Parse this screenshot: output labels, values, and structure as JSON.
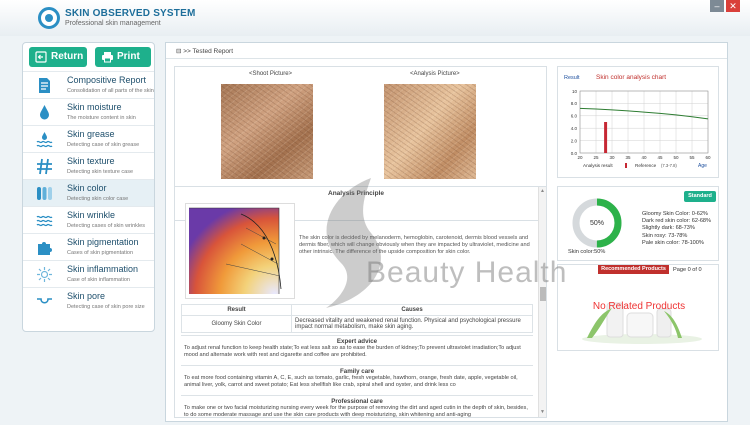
{
  "app": {
    "title": "SKIN OBSERVED SYSTEM",
    "subtitle": "Professional skin management"
  },
  "window": {
    "min": "–",
    "close": "✕"
  },
  "toolbar": {
    "return_label": "Return",
    "print_label": "Print"
  },
  "sidebar": {
    "items": [
      {
        "title": "Compositive Report",
        "sub": "Consolidation of all parts of the skin",
        "icon": "document-icon"
      },
      {
        "title": "Skin moisture",
        "sub": "The moisture content in skin",
        "icon": "water-drop-icon"
      },
      {
        "title": "Skin grease",
        "sub": "Detecting case of skin grease",
        "icon": "grease-waves-icon"
      },
      {
        "title": "Skin texture",
        "sub": "Detecting skin texture case",
        "icon": "texture-hash-icon"
      },
      {
        "title": "Skin color",
        "sub": "Detecting skin color case",
        "icon": "color-bars-icon"
      },
      {
        "title": "Skin wrinkle",
        "sub": "Detecting cases of skin wrinkles",
        "icon": "wrinkle-lines-icon"
      },
      {
        "title": "Skin pigmentation",
        "sub": "Cases of skin pigmentation",
        "icon": "pigment-puzzle-icon"
      },
      {
        "title": "Skin inflammation",
        "sub": "Case of skin inflammation",
        "icon": "inflammation-burst-icon"
      },
      {
        "title": "Skin pore",
        "sub": "Detecting case of skin pore size",
        "icon": "pore-cup-icon"
      }
    ]
  },
  "breadcrumb": "Tested Report",
  "photos": {
    "shoot_label": "<Shoot Picture>",
    "analysis_label": "<Analysis Picture>"
  },
  "chart_data": {
    "type": "line",
    "title": "Skin color analysis chart",
    "ylabel": "Result",
    "xlabel": "Age",
    "x_ticks": [
      20,
      25,
      30,
      35,
      40,
      45,
      50,
      55,
      60
    ],
    "y_ticks": [
      0.0,
      2.0,
      4.0,
      6.0,
      8.0,
      10
    ],
    "xlim": [
      20,
      60
    ],
    "ylim": [
      0,
      10
    ],
    "series": [
      {
        "name": "Reference",
        "x": [
          20,
          25,
          30,
          35,
          40,
          45,
          50,
          55,
          60
        ],
        "values": [
          7.2,
          7.1,
          6.95,
          6.8,
          6.6,
          6.4,
          6.15,
          5.85,
          5.5
        ]
      },
      {
        "name": "Analysis result",
        "type": "bar",
        "x": [
          28
        ],
        "values": [
          5.0
        ]
      }
    ],
    "legend": {
      "result_label": "Analysis result",
      "reference_label": "Reference",
      "reference_range": "(7.3-7.8)"
    },
    "colors": {
      "reference": "#2e7d32",
      "result": "#c62834",
      "title": "#c0302d"
    }
  },
  "analysis": {
    "title": "Analysis Principle",
    "principle_text": "The skin color is decided by melanoderm, hemoglobin, carotenoid, dermis blood vessels and dermis fiber, which will change obviously when they are impacted by ultraviolet, medicine and other intrinsic. The difference of the upside composition for skin color.",
    "table": {
      "headers": [
        "Result",
        "Causes"
      ],
      "row": [
        "Gloomy Skin Color",
        "Decreased vitality and weakened renal function. Physical and psychological pressure impact normal metabolism, make skin aging."
      ]
    },
    "expert": {
      "title": "Expert advice",
      "text": "To adjust renal function to keep health state;To eat less salt so as to ease the burden of kidney;To prevent ultraviolet irradiation;To adjust mood and alternate work with rest and cigarette and coffee are prohibited."
    },
    "family": {
      "title": "Family care",
      "text": "To eat more food containing vitamin A, C, E, such as tomato, garlic, fresh vegetable, hawthorn, orange, fresh date, apple, vegetable oil, animal liver, yolk, carrot and sweet potato; Eat less shellfish like crab, spiral shell and oyster, and drink less co"
    },
    "professional": {
      "title": "Professional care",
      "text": "To make one or two facial moisturizing nursing every week for the purpose of removing the dirt and aged cutin in the depth of skin, besides, to do some moderate massage and use the skin care products with deep moisturizing, skin whitening and anti-aging"
    }
  },
  "standard": {
    "badge": "Standard",
    "percent": "50%",
    "percent_value": 0.5,
    "caption": "Skin color:50%",
    "ranges": [
      "Gloomy Skin Color: 0-62%",
      "Dark red skin color: 62-68%",
      "Slightly dark: 68-73%",
      "Skin rosy: 73-78%",
      "Pale skin color: 78-100%"
    ],
    "colors": {
      "ring": "#2db24a",
      "track": "#d5d9dc"
    }
  },
  "products": {
    "header": "Recommended Products",
    "page": "Page 0 of 0",
    "empty": "No Related Products"
  },
  "watermark": "Beauty Health"
}
